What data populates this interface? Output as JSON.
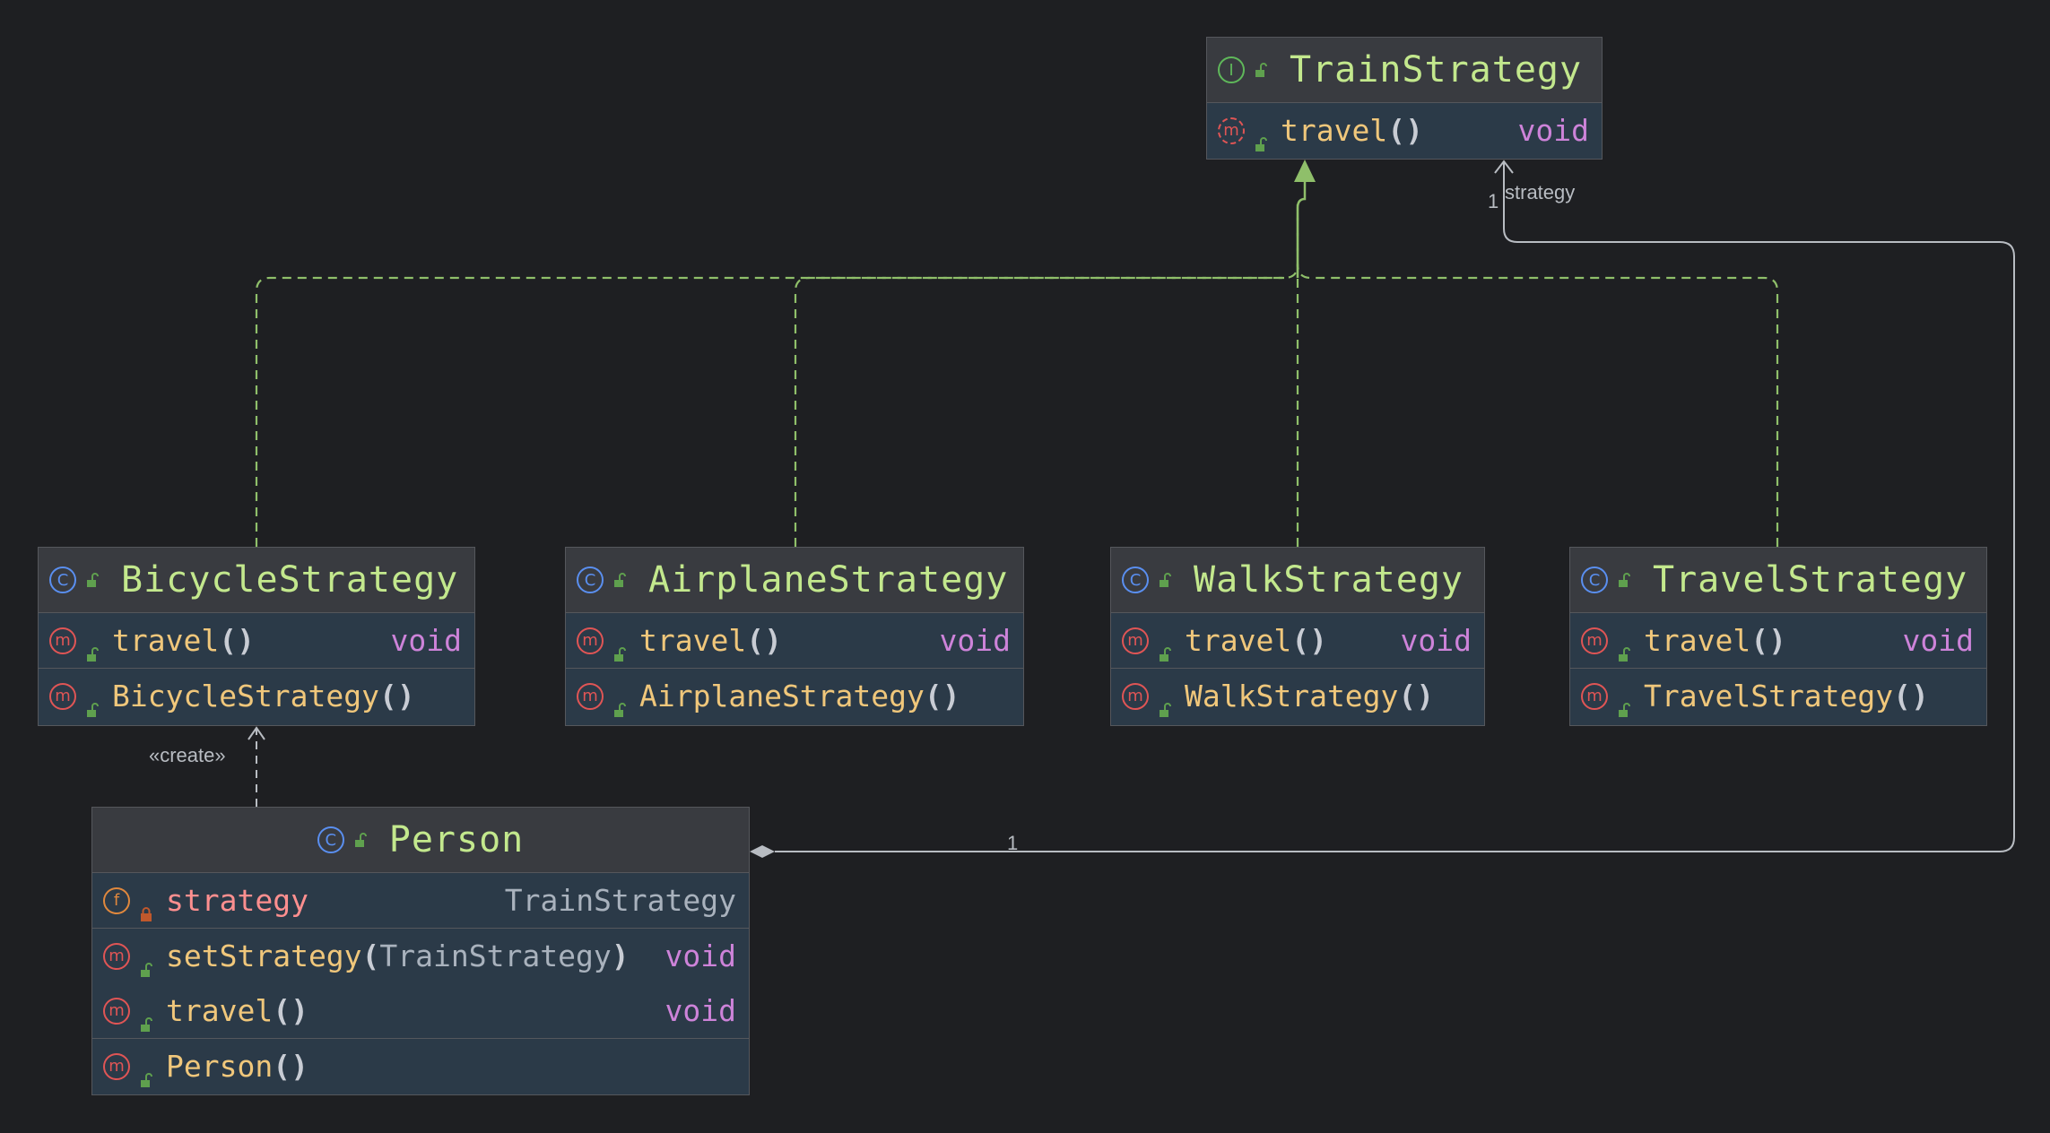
{
  "interface": {
    "name": "TrainStrategy",
    "methods": [
      {
        "name": "travel",
        "params": "",
        "return_type": "void"
      }
    ]
  },
  "classes": [
    {
      "name": "BicycleStrategy",
      "methods": [
        {
          "name": "travel",
          "params": "",
          "return_type": "void"
        }
      ],
      "constructors": [
        {
          "name": "BicycleStrategy",
          "params": ""
        }
      ]
    },
    {
      "name": "AirplaneStrategy",
      "methods": [
        {
          "name": "travel",
          "params": "",
          "return_type": "void"
        }
      ],
      "constructors": [
        {
          "name": "AirplaneStrategy",
          "params": ""
        }
      ]
    },
    {
      "name": "WalkStrategy",
      "methods": [
        {
          "name": "travel",
          "params": "",
          "return_type": "void"
        }
      ],
      "constructors": [
        {
          "name": "WalkStrategy",
          "params": ""
        }
      ]
    },
    {
      "name": "TravelStrategy",
      "methods": [
        {
          "name": "travel",
          "params": "",
          "return_type": "void"
        }
      ],
      "constructors": [
        {
          "name": "TravelStrategy",
          "params": ""
        }
      ]
    }
  ],
  "person": {
    "name": "Person",
    "fields": [
      {
        "name": "strategy",
        "type": "TrainStrategy"
      }
    ],
    "methods": [
      {
        "name": "setStrategy",
        "params": "TrainStrategy",
        "return_type": "void"
      },
      {
        "name": "travel",
        "params": "",
        "return_type": "void"
      }
    ],
    "constructors": [
      {
        "name": "Person",
        "params": ""
      }
    ]
  },
  "relations": {
    "create_label": "«create»",
    "association_role": "strategy",
    "association_target_multiplicity": "1",
    "composition_multiplicity": "1"
  },
  "icons": {
    "class": "C",
    "interface": "I",
    "method": "m",
    "field": "f",
    "public": "unlock-icon",
    "private": "lock-icon"
  },
  "colors": {
    "background": "#1e1f22",
    "header": "#393b40",
    "body": "#2b3a48",
    "class_name": "#c3e88d",
    "method_name": "#f0c77b",
    "return_type": "#cd83d9",
    "field_name": "#ff8f8f",
    "realization_line": "#8fbf6a",
    "association_line": "#b8bcc2"
  }
}
